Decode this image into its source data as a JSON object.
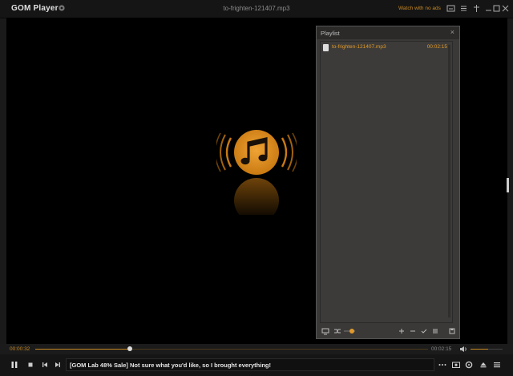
{
  "app": {
    "name": "GOM Player",
    "title": "to-frighten-121407.mp3",
    "ads_label": "Watch with no ads"
  },
  "playlist": {
    "title": "Playlist",
    "close_label": "×",
    "items": [
      {
        "name": "to-frighten-121407.mp3",
        "duration": "00:02:15"
      }
    ]
  },
  "player": {
    "current_time": "00:00:32",
    "total_time": "00:02:15",
    "progress": 0.24,
    "volume": 0.55
  },
  "banner": {
    "text": "[GOM Lab 48% Sale] Not sure what you'd like, so I brought everything!"
  },
  "colors": {
    "accent": "#c98a22",
    "playlist_bg": "#3b3937",
    "video_bg": "#000000"
  },
  "icons": {
    "title_bar": [
      "gear-icon",
      "subtitle-icon",
      "list-icon",
      "pin-icon",
      "minimize-icon",
      "maximize-icon",
      "close-icon"
    ],
    "playlist_tools": [
      "repeat-icon",
      "shuffle-icon",
      "add-icon",
      "remove-icon",
      "check-icon",
      "list-icon",
      "save-icon"
    ],
    "controls": [
      "pause-icon",
      "stop-icon",
      "previous-icon",
      "next-icon",
      "more-icon",
      "capture-icon",
      "settings-icon",
      "eject-icon",
      "menu-icon"
    ]
  }
}
